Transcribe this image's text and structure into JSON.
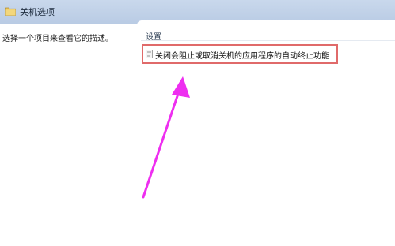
{
  "window": {
    "title": "关机选项",
    "icon": "folder-icon"
  },
  "left_panel": {
    "description": "选择一个项目来查看它的描述。"
  },
  "settings_list": {
    "column_header": "设置",
    "items": [
      {
        "label": "关闭会阻止或取消关机的应用程序的自动终止功能",
        "icon": "policy-setting-icon"
      }
    ]
  },
  "annotation": {
    "highlight_color": "#e06a6a",
    "arrow_color": "#ee2ef0"
  }
}
